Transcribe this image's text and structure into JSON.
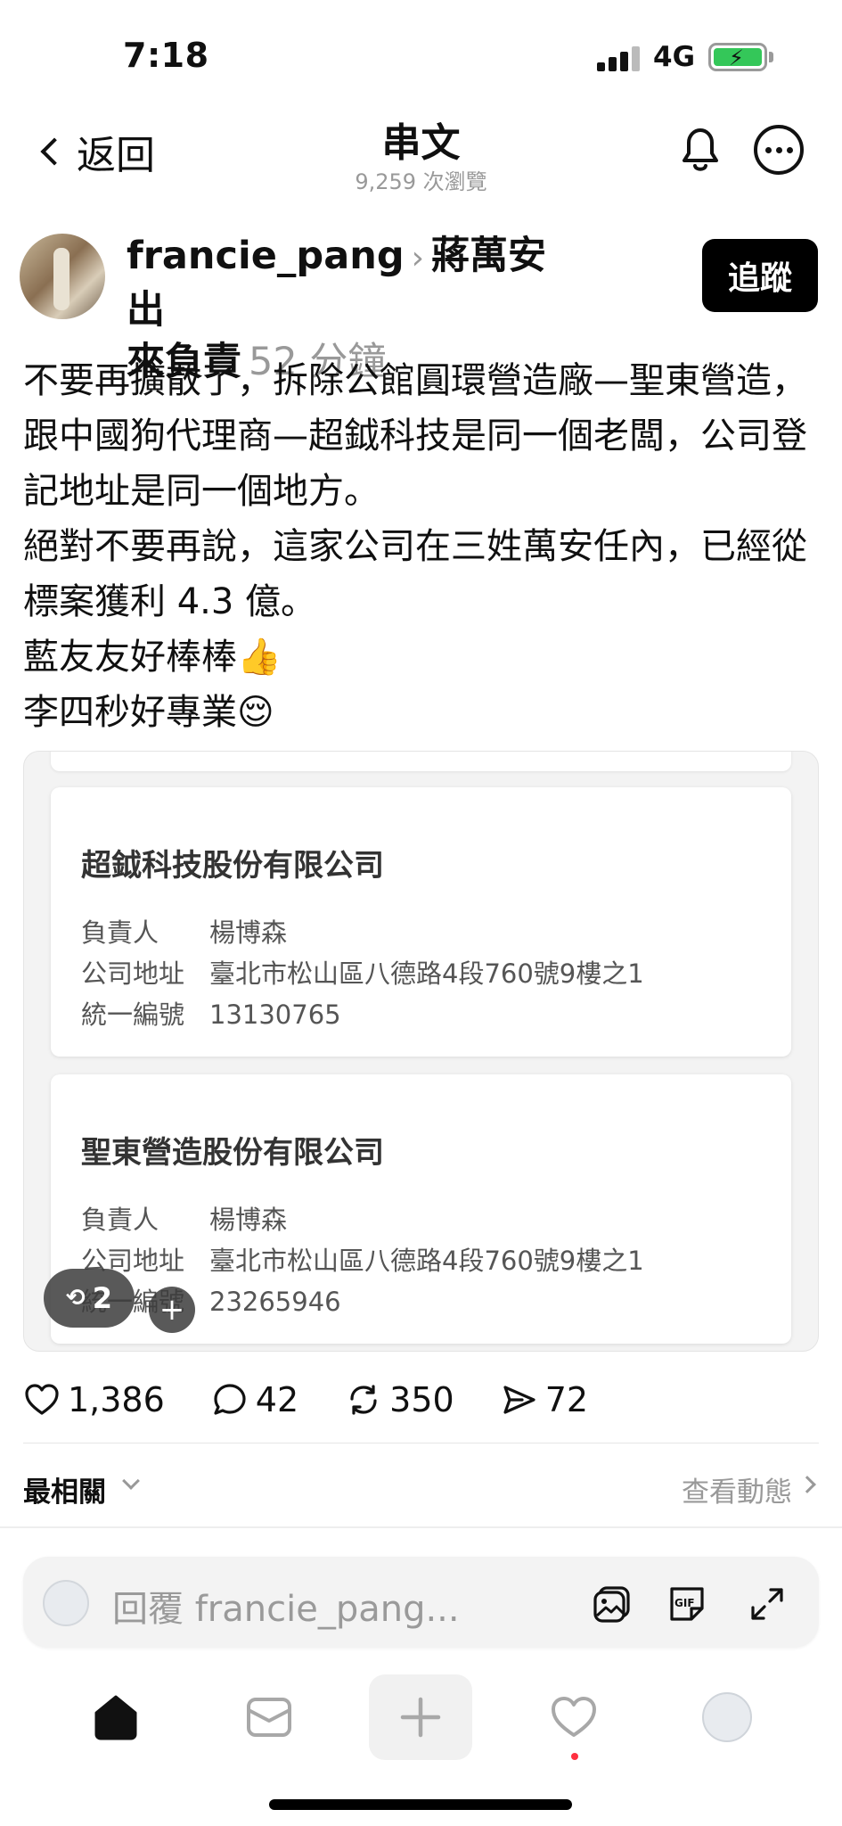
{
  "status_bar": {
    "time": "7:18",
    "network": "4G"
  },
  "nav": {
    "back_label": "返回",
    "title": "串文",
    "views": "9,259 次瀏覽"
  },
  "post": {
    "username": "francie_pang",
    "topic_part1": "蔣萬安出",
    "topic_part2": "來負責",
    "time_ago": "52 分鐘",
    "follow_label": "追蹤",
    "body_lines": [
      "不要再擴散了，拆除公館圓環營造廠—聖東營造，跟中國狗代理商—超鉞科技是同一個老闆，公司登記地址是同一個地方。",
      "絕對不要再說，這家公司在三姓萬安任內，已經從標案獲利 4.3 億。",
      "藍友友好棒棒👍",
      "李四秒好專業😌"
    ]
  },
  "companies": [
    {
      "name": "超鉞科技股份有限公司",
      "rows": [
        {
          "k": "負責人",
          "v": "楊博森"
        },
        {
          "k": "公司地址",
          "v": "臺北市松山區八德路4段760號9樓之1"
        },
        {
          "k": "統一編號",
          "v": "13130765"
        }
      ]
    },
    {
      "name": "聖東營造股份有限公司",
      "rows": [
        {
          "k": "負責人",
          "v": "楊博森"
        },
        {
          "k": "公司地址",
          "v": "臺北市松山區八德路4段760號9樓之1"
        },
        {
          "k": "統一編號",
          "v": "23265946"
        }
      ]
    }
  ],
  "media_overlay": {
    "repost_count": "2",
    "plus": "+"
  },
  "actions": {
    "likes": "1,386",
    "comments": "42",
    "reposts": "350",
    "shares": "72"
  },
  "sort": {
    "label": "最相關",
    "activity_link": "查看動態"
  },
  "reply": {
    "placeholder": "回覆 francie_pang..."
  },
  "colors": {
    "accent_green": "#34c759",
    "notification_dot": "#ff3040",
    "follow_bg": "#000000"
  }
}
